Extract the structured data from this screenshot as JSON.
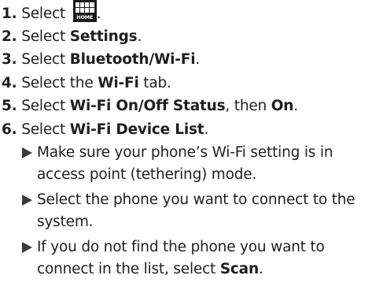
{
  "steps": [
    {
      "num": "1.",
      "pre": "Select ",
      "icon": "home-icon",
      "icon_text": "HOME",
      "post": "."
    },
    {
      "num": "2.",
      "pre": "Select ",
      "bold": "Settings",
      "post": "."
    },
    {
      "num": "3.",
      "pre": "Select ",
      "bold": "Bluetooth/Wi-Fi",
      "post": "."
    },
    {
      "num": "4.",
      "pre": "Select the ",
      "bold": "Wi-Fi",
      "post": " tab."
    },
    {
      "num": "5.",
      "pre": "Select ",
      "bold": "Wi-Fi On/Off Status",
      "mid": ", then ",
      "bold2": "On",
      "post": "."
    },
    {
      "num": "6.",
      "pre": "Select ",
      "bold": "Wi-Fi Device List",
      "post": "."
    }
  ],
  "notes": [
    {
      "text": "Make sure your phone’s Wi-Fi setting is in access point (tethering) mode."
    },
    {
      "text": "Select the phone you want to connect to the system."
    },
    {
      "pre": "If you do not find the phone you want to connect in the list, select ",
      "bold": "Scan",
      "post": "."
    }
  ]
}
